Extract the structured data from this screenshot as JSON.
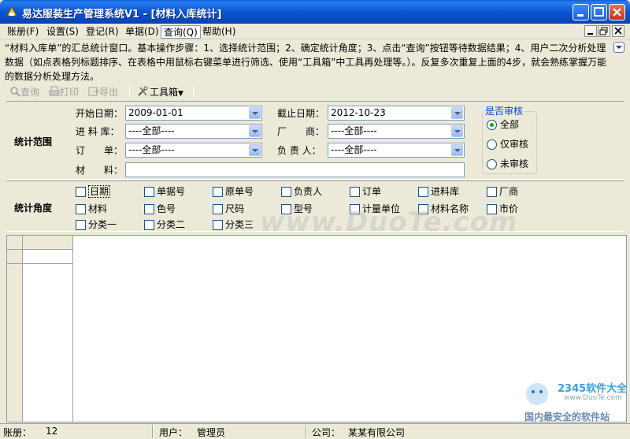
{
  "window": {
    "title": "易达服装生产管理系统V1 - [材料入库统计]"
  },
  "menu": {
    "items": [
      "账册(F)",
      "设置(S)",
      "登记(R)",
      "单据(D)",
      "查询(Q)",
      "帮助(H)"
    ],
    "active": "查询(Q)"
  },
  "help": {
    "text": "“材料入库单”的汇总统计窗口。基本操作步骤：1、选择统计范围；2、确定统计角度；3、点击“查询”按钮等待数据结果；4、用户二次分析处理数据（如点表格列标题排序、在表格中用鼠标右键菜单进行筛选、使用“工具箱”中工具再处理等。）。反复多次重复上面的4步，就会熟练掌握万能的数据分析处理方法。"
  },
  "toolbar": {
    "query": "查询",
    "print": "打印",
    "export": "导出",
    "toolbox": "工具箱"
  },
  "range": {
    "title": "统计范围",
    "start_label": "开始日期：",
    "start_value": "2009-01-01",
    "end_label": "截止日期：",
    "end_value": "2012-10-23",
    "warehouse_label": "进 料 库：",
    "warehouse_value": "----全部----",
    "vendor_label": "厂　　商：",
    "vendor_value": "----全部----",
    "order_label": "订　　单：",
    "order_value": "----全部----",
    "owner_label": "负 责 人：",
    "owner_value": "----全部----",
    "material_label": "材　　料：",
    "material_value": ""
  },
  "audit": {
    "title": "是否审核",
    "options": [
      "全部",
      "仅审核",
      "未审核"
    ],
    "selected": "全部"
  },
  "angle": {
    "title": "统计角度",
    "checks": [
      "日期",
      "单据号",
      "原单号",
      "负责人",
      "订单",
      "进料库",
      "厂商",
      "材料",
      "色号",
      "尺码",
      "型号",
      "计量单位",
      "材料名称",
      "市价",
      "分类一",
      "分类二",
      "分类三"
    ]
  },
  "watermark": {
    "text": "www.DuoTe.com",
    "logo_main": "2345软件大全",
    "logo_url": "www.DuoTe.com",
    "logo_slogan": "国内最安全的软件站"
  },
  "status": {
    "book_label": "账册：",
    "book_value": "12",
    "user_label": "用户：",
    "user_value": "管理员",
    "company_label": "公司：",
    "company_value": "某某有限公司"
  },
  "colors": {
    "titlebar": "#0a55d0",
    "window_bg": "#ece9d8",
    "accent_blue": "#0046d5",
    "radio_dot": "#21a121"
  }
}
